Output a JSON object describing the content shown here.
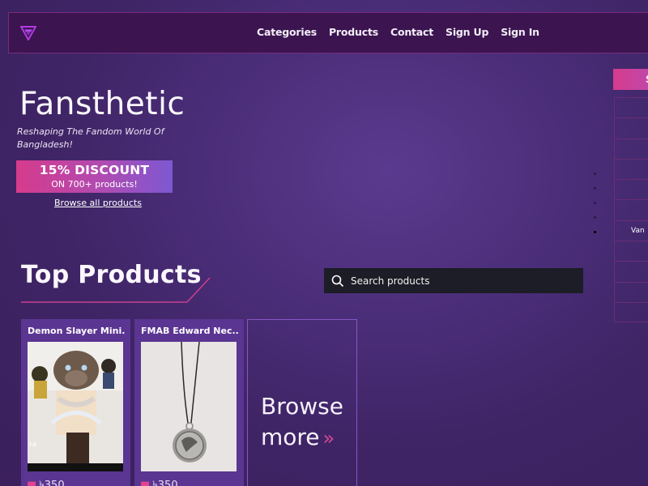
{
  "nav": {
    "logo_icon": "triangle-logo-icon",
    "links": [
      "Categories",
      "Products",
      "Contact",
      "Sign Up",
      "Sign In"
    ]
  },
  "hero": {
    "title": "Fansthetic",
    "subtitle": "Reshaping The Fandom World Of Bangladesh!",
    "discount_main": "15% DISCOUNT",
    "discount_sub": "ON 700+ products!",
    "browse_all": "Browse all products"
  },
  "section": {
    "title": "Top Products"
  },
  "search": {
    "placeholder": "Search products",
    "icon": "search-icon"
  },
  "products": [
    {
      "title": "Demon Slayer Mini...",
      "price": "৳350",
      "image_caption": "ra"
    },
    {
      "title": "FMAB Edward Nec...",
      "price": "৳350"
    }
  ],
  "browse_more": {
    "line1": "Browse",
    "line2": "more",
    "arrow": "»"
  },
  "sidebar_peek": {
    "button_letter": "S",
    "row_text": "Van"
  },
  "colors": {
    "accent_pink": "#d63b8c",
    "accent_purple": "#7d58d2",
    "navbar_bg": "#3b1450",
    "card_bg": "#5b3592",
    "search_bg": "#1c1d26"
  }
}
